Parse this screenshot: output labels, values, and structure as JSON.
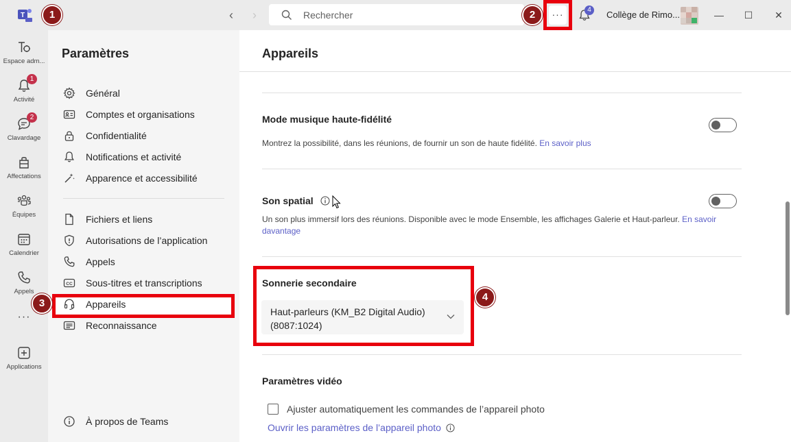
{
  "titlebar": {
    "search_placeholder": "Rechercher",
    "more_label": "···",
    "notifications_count": "4",
    "org_name": "Collège de Rimo...",
    "minimize": "—",
    "maximize": "☐",
    "close": "✕"
  },
  "rail": {
    "items": [
      {
        "label": "Espace adm...",
        "icon": "admin-icon"
      },
      {
        "label": "Activité",
        "icon": "bell-icon",
        "badge": "1"
      },
      {
        "label": "Clavardage",
        "icon": "chat-icon",
        "badge": "2"
      },
      {
        "label": "Affectations",
        "icon": "assignments-icon"
      },
      {
        "label": "Équipes",
        "icon": "teams-icon"
      },
      {
        "label": "Calendrier",
        "icon": "calendar-icon"
      },
      {
        "label": "Appels",
        "icon": "phone-icon"
      },
      {
        "label": "Applications",
        "icon": "add-apps-icon"
      }
    ],
    "more": "···"
  },
  "settings_nav": {
    "title": "Paramètres",
    "items": [
      {
        "label": "Général",
        "icon": "gear-icon"
      },
      {
        "label": "Comptes et organisations",
        "icon": "id-card-icon"
      },
      {
        "label": "Confidentialité",
        "icon": "lock-icon"
      },
      {
        "label": "Notifications et activité",
        "icon": "bell-icon"
      },
      {
        "label": "Apparence et accessibilité",
        "icon": "magic-wand-icon"
      },
      {
        "label": "Fichiers et liens",
        "icon": "file-icon"
      },
      {
        "label": "Autorisations de l’application",
        "icon": "shield-icon"
      },
      {
        "label": "Appels",
        "icon": "phone-icon"
      },
      {
        "label": "Sous-titres et transcriptions",
        "icon": "cc-icon"
      },
      {
        "label": "Appareils",
        "icon": "headset-icon",
        "active": true
      },
      {
        "label": "Reconnaissance",
        "icon": "recognition-icon"
      }
    ],
    "about": "À propos de Teams"
  },
  "main": {
    "title": "Appareils",
    "hifi": {
      "title": "Mode musique haute-fidélité",
      "desc": "Montrez la possibilité, dans les réunions, de fournir un son de haute fidélité. ",
      "link": "En savoir plus",
      "enabled": false
    },
    "spatial": {
      "title": "Son spatial",
      "desc_line1": "Un son plus immersif lors des réunions. Disponible avec le mode Ensemble, les affichages Galerie et Haut-parleur. ",
      "link1": "En savoir",
      "link2": "davantage",
      "enabled": false
    },
    "secondary_ringer": {
      "title": "Sonnerie secondaire",
      "selected_line1": "Haut-parleurs (KM_B2 Digital Audio)",
      "selected_line2": "(8087:1024)"
    },
    "video": {
      "title": "Paramètres vidéo",
      "auto_adjust_label": "Ajuster automatiquement les commandes de l’appareil photo",
      "auto_adjust_checked": false,
      "camera_link": "Ouvrir les paramètres de l’appareil photo"
    }
  },
  "steps": [
    "1",
    "2",
    "3",
    "4"
  ],
  "colors": {
    "accent": "#5b5fc7",
    "highlight": "#e8000d",
    "step_marker": "#8b1a1a",
    "badge": "#c4314b"
  }
}
